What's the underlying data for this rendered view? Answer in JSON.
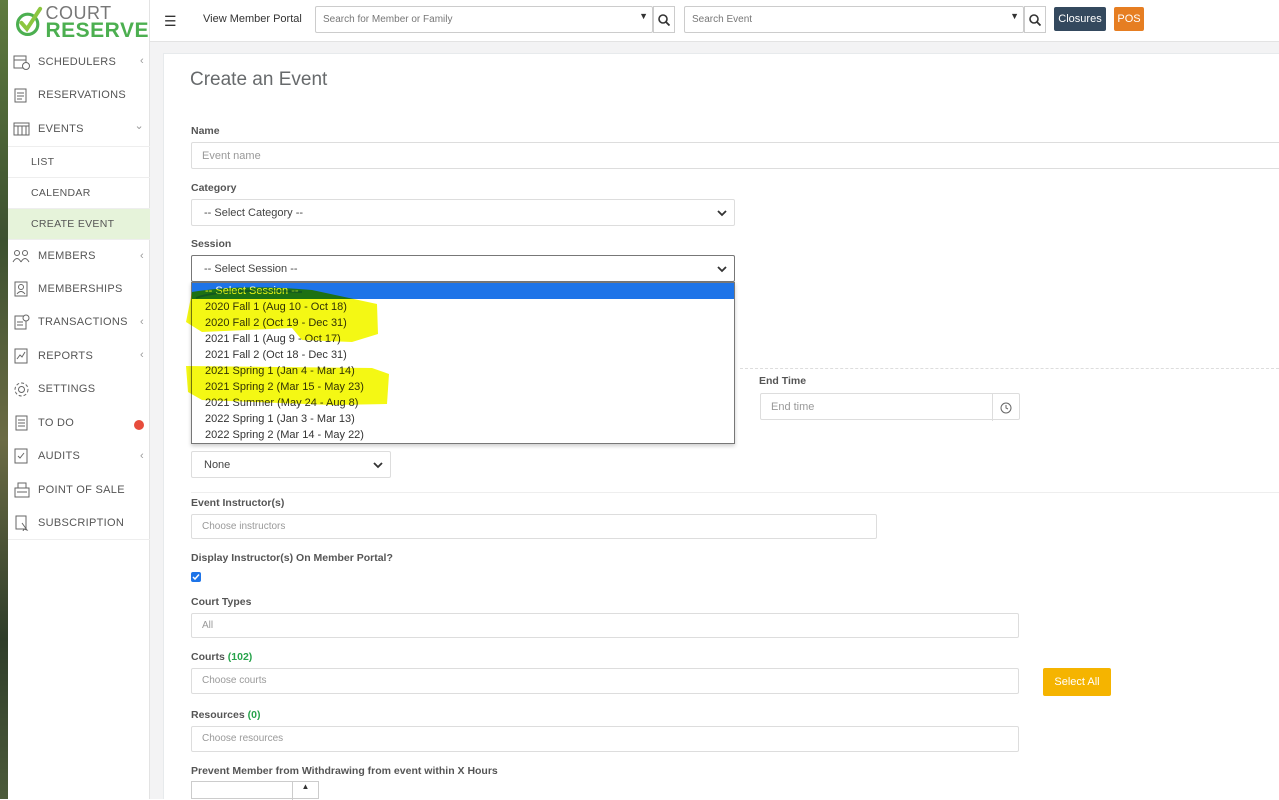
{
  "logo": {
    "line1": "COURT",
    "line2": "RESERVE"
  },
  "sidebar": {
    "items": [
      {
        "label": "SCHEDULERS",
        "icon": "scheduler-icon",
        "chevron": "‹"
      },
      {
        "label": "RESERVATIONS",
        "icon": "reservations-icon",
        "chevron": ""
      },
      {
        "label": "EVENTS",
        "icon": "events-icon",
        "chevron": "⌄"
      },
      {
        "label": "MEMBERS",
        "icon": "members-icon",
        "chevron": "‹"
      },
      {
        "label": "MEMBERSHIPS",
        "icon": "memberships-icon",
        "chevron": ""
      },
      {
        "label": "TRANSACTIONS",
        "icon": "transactions-icon",
        "chevron": "‹"
      },
      {
        "label": "REPORTS",
        "icon": "reports-icon",
        "chevron": "‹"
      },
      {
        "label": "SETTINGS",
        "icon": "gear-icon",
        "chevron": ""
      },
      {
        "label": "TO DO",
        "icon": "todo-icon",
        "chevron": ""
      },
      {
        "label": "AUDITS",
        "icon": "audits-icon",
        "chevron": "‹"
      },
      {
        "label": "POINT OF SALE",
        "icon": "pos-icon",
        "chevron": ""
      },
      {
        "label": "SUBSCRIPTION",
        "icon": "subscription-icon",
        "chevron": ""
      }
    ],
    "events_sub": [
      {
        "label": "LIST"
      },
      {
        "label": "CALENDAR"
      },
      {
        "label": "CREATE EVENT"
      }
    ]
  },
  "topbar": {
    "view_portal": "View Member Portal",
    "member_search_placeholder": "Search for Member or Family",
    "event_search_placeholder": "Search Event",
    "closures_label": "Closures",
    "pos_label": "POS"
  },
  "form": {
    "title": "Create an Event",
    "name_label": "Name",
    "name_placeholder": "Event name",
    "category_label": "Category",
    "category_value": "-- Select Category --",
    "session_label": "Session",
    "session_value": "-- Select Session --",
    "session_options": [
      "-- Select Session --",
      "2020 Fall 1 (Aug 10 - Oct 18)",
      "2020 Fall 2 (Oct 19 - Dec 31)",
      "2021 Fall 1 (Aug 9 - Oct 17)",
      "2021 Fall 2 (Oct 18 - Dec 31)",
      "2021 Spring 1 (Jan 4 - Mar 14)",
      "2021 Spring 2 (Mar 15 - May 23)",
      "2021 Summer (May 24 - Aug 8)",
      "2022 Spring 1 (Jan 3 - Mar 13)",
      "2022 Spring 2 (Mar 14 - May 22)"
    ],
    "end_time_label": "End Time",
    "end_time_placeholder": "End time",
    "none_value": "None",
    "instructors_label": "Event Instructor(s)",
    "instructors_placeholder": "Choose instructors",
    "display_instructors_label": "Display Instructor(s) On Member Portal?",
    "display_instructors_checked": true,
    "court_types_label": "Court Types",
    "court_types_placeholder": "All",
    "courts_label": "Courts",
    "courts_count": "(102)",
    "courts_placeholder": "Choose courts",
    "select_all_label": "Select All",
    "resources_label": "Resources",
    "resources_count": "(0)",
    "resources_placeholder": "Choose resources",
    "prevent_withdraw_label": "Prevent Member from Withdrawing from event within X Hours"
  },
  "colors": {
    "accent_green": "#4caf50",
    "highlight_yellow": "#f3f700",
    "selected_blue": "#1e74e8",
    "closures": "#34495e",
    "pos": "#e67e22",
    "select_all": "#f5b400"
  }
}
